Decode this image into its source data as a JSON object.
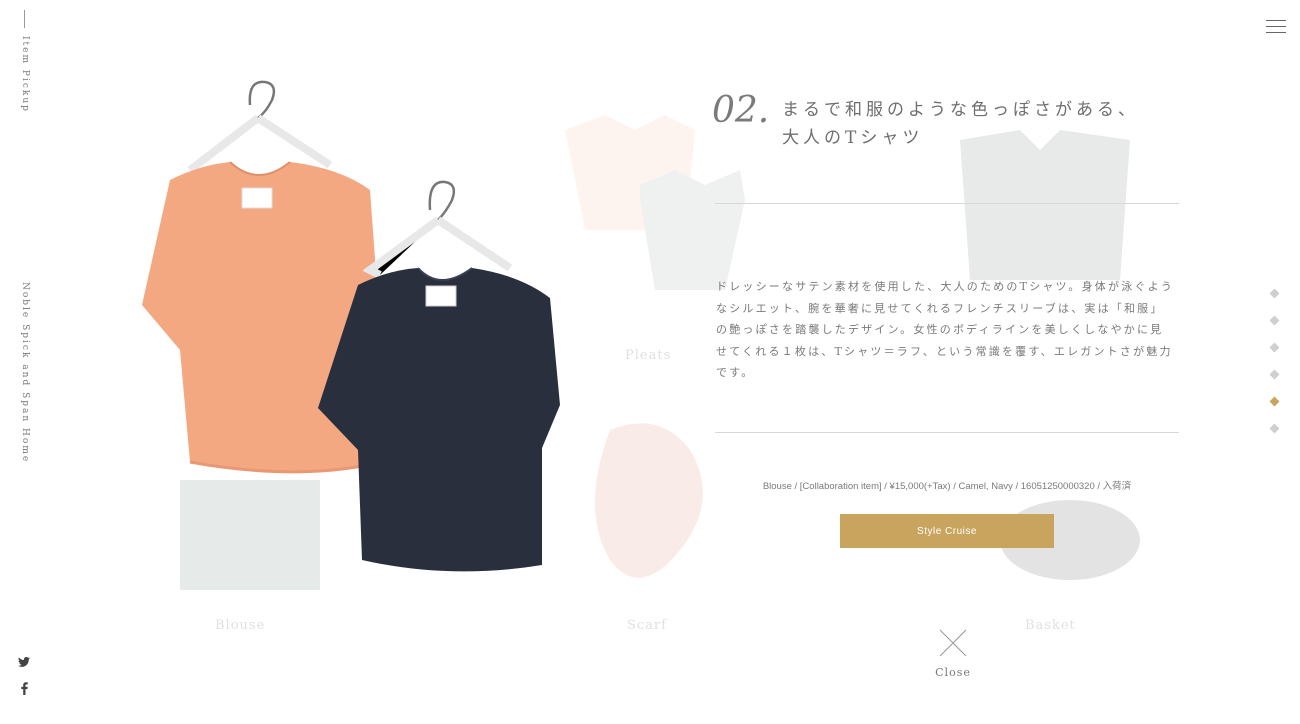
{
  "sidebar": {
    "section_label": "Item Pickup",
    "brand_label": "Noble Spick and Span Home",
    "social": {
      "twitter": "twitter-icon",
      "facebook": "facebook-icon"
    }
  },
  "header": {
    "menu_icon": "hamburger-icon"
  },
  "item": {
    "number": "02.",
    "headline_line1": "まるで和服のような色っぽさがある、",
    "headline_line2": "大人のTシャツ",
    "description": "ドレッシーなサテン素材を使用した、大人のためのTシャツ。身体が泳ぐようなシルエット、腕を華奢に見せてくれるフレンチスリーブは、実は「和服」の艶っぽさを踏襲したデザイン。女性のボディラインを美しくしなやかに見せてくれる１枚は、Tシャツ＝ラフ、という常識を覆す、エレガントさが魅力です。",
    "meta": "Blouse / [Collaboration item] / ¥15,000(+Tax) / Camel, Navy / 16051250000320 / 入荷済",
    "cta_label": "Style Cruise",
    "close_label": "Close"
  },
  "pagination": {
    "count": 6,
    "active_index": 4
  },
  "colors": {
    "accent": "#c9a45e",
    "camel": "#f4a882",
    "navy": "#2a2f3e"
  }
}
